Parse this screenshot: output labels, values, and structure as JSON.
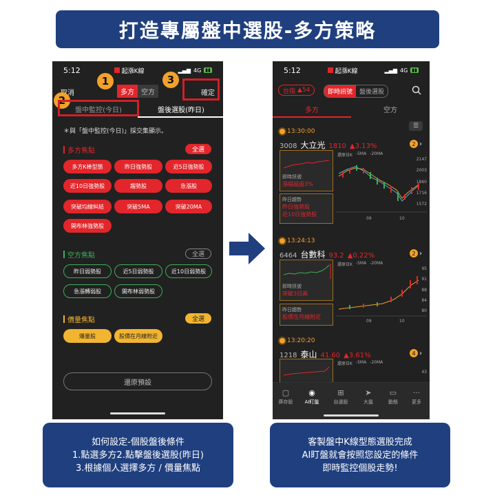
{
  "banner": {
    "title": "打造專屬盤中選股-多方策略"
  },
  "left_phone": {
    "time": "5:12",
    "app": "起漲K線",
    "signal": "4G",
    "cancel": "取消",
    "seg_long": "多方",
    "seg_short": "空方",
    "confirm": "確定",
    "tab_intraday": "盤中監控(今日)",
    "tab_after": "盤後選股(昨日)",
    "note": "＊與「盤中監控(今日)」採交集顯示。",
    "long": {
      "title": "多方焦點",
      "all": "全選",
      "chips": [
        "多方K棒型態",
        "昨日強勢股",
        "近5日強勢股",
        "近10日強勢股",
        "趨勢股",
        "急漲股",
        "突破均線糾結",
        "突破5MA",
        "突破20MA",
        "開布林強勢股"
      ]
    },
    "short": {
      "title": "空方焦點",
      "all": "全選",
      "chips": [
        "昨日弱勢股",
        "近5日弱勢股",
        "近10日弱勢股",
        "急漲轉弱股",
        "開布林弱勢股"
      ]
    },
    "volume": {
      "title": "價量焦點",
      "all": "全選",
      "chips": [
        "爆量股",
        "股價在月線附近"
      ]
    },
    "reset": "還原預設"
  },
  "markers": [
    "1",
    "2",
    "3"
  ],
  "right_phone": {
    "time": "5:12",
    "app": "起漲K線",
    "signal": "4G",
    "index_label": "台指",
    "index_change": "▲54",
    "tab_realtime": "即時訊號",
    "tab_after": "盤後選股",
    "sub_long": "多方",
    "sub_short": "空方",
    "stocks": [
      {
        "time": "13:30:00",
        "code": "3008",
        "name": "大立光",
        "price": "1810",
        "change": "▲3.13%",
        "badge": "2",
        "rt_label": "即時訊號",
        "rt_signal": "漲幅超過3%",
        "trend_label": "昨日趨勢",
        "trend": [
          "昨日強勢股",
          "近10日強勢股"
        ],
        "legend": [
          "還原日K",
          "-5MA",
          "-20MA"
        ],
        "y": [
          "2147",
          "2003",
          "1860",
          "1716",
          "1572"
        ],
        "x": [
          "09",
          "10"
        ]
      },
      {
        "time": "13:24:13",
        "code": "6464",
        "name": "台數科",
        "price": "93.2",
        "change": "▲0.22%",
        "badge": "2",
        "rt_label": "即時訊號",
        "rt_signal": "突破3日高",
        "trend_label": "昨日趨勢",
        "trend": [
          "股價在月線附近"
        ],
        "legend": [
          "還原日K",
          "-5MA",
          "-20MA"
        ],
        "y": [
          "95",
          "91",
          "88",
          "84",
          "80"
        ],
        "x": [
          "09",
          "10"
        ]
      },
      {
        "time": "13:20:20",
        "code": "1218",
        "name": "泰山",
        "price": "41.60",
        "change": "▲3.61%",
        "badge": "4",
        "legend": [
          "還原日K",
          "-5MA",
          "-20MA"
        ],
        "y": [
          "43"
        ]
      }
    ],
    "tabbar": [
      "庫存股",
      "AI盯盤",
      "自選股",
      "大盤",
      "動態",
      "更多"
    ]
  },
  "captions": {
    "left": [
      "如何設定-個股盤後條件",
      "1.點選多方2.點擊盤後選股(昨日)",
      "3.根據個人選擇多方 / 價量焦點"
    ],
    "right": [
      "客製盤中K線型態選股完成",
      "AI盯盤就會按照您設定的條件",
      "即時監控個股走勢!"
    ]
  },
  "colors": {
    "brand": "#1f3f7f",
    "up": "#e2262b",
    "accent": "#f2a12b",
    "green": "#3fae5b",
    "volume": "#f2b531"
  }
}
